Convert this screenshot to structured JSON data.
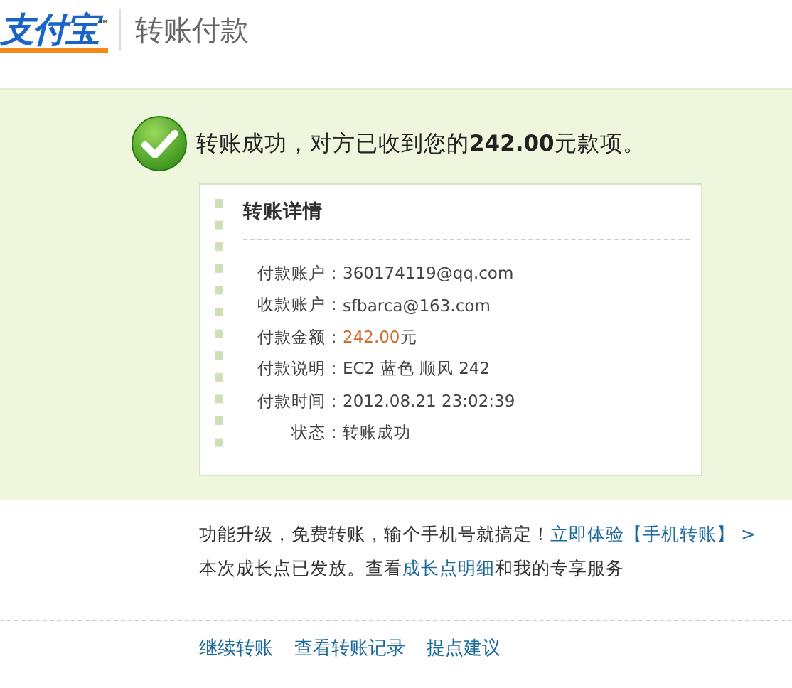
{
  "header": {
    "logo": "支付宝",
    "trademark": "™",
    "title": "转账付款"
  },
  "result": {
    "message": "转账成功，对方已收到您的**242.00**元款项。"
  },
  "details": {
    "title": "转账详情",
    "rows": [
      {
        "kind": "text",
        "label": "付款账户：",
        "value": "360174119@qq.com"
      },
      {
        "kind": "text",
        "label": "收款账户：",
        "value": "sfbarca@163.com"
      },
      {
        "kind": "amount",
        "label": "付款金额：",
        "value": "242.00",
        "unit": "元"
      },
      {
        "kind": "text",
        "label": "付款说明：",
        "value": "EC2 蓝色 顺风 242"
      },
      {
        "kind": "text",
        "label": "付款时间：",
        "value": "2012.08.21 23:02:39"
      },
      {
        "kind": "text",
        "label": "状态：",
        "value": "转账成功"
      }
    ]
  },
  "notices": [
    {
      "before": "功能升级，免费转账，输个手机号就搞定！",
      "link": "立即体验【手机转账】 >"
    },
    {
      "before": "本次成长点已发放。查看",
      "link": "成长点明细",
      "after": "和我的专享服务"
    }
  ],
  "footer_links": [
    "继续转账",
    "查看转账记录",
    "提点建议"
  ]
}
